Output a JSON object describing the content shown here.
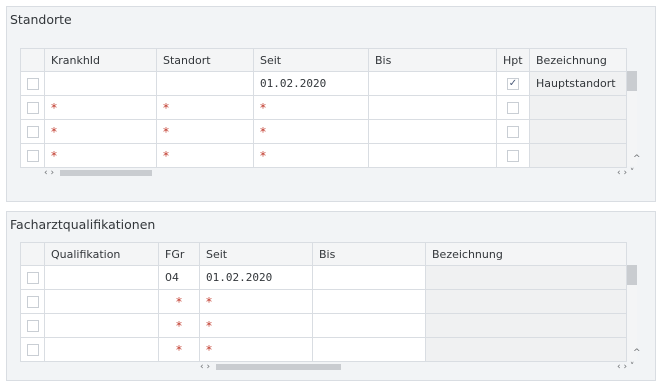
{
  "standorte": {
    "title": "Standorte",
    "columns": [
      "KrankhId",
      "Standort",
      "Seit",
      "Bis",
      "Hpt",
      "Bezeichnung"
    ],
    "rows": [
      {
        "krankhid": "",
        "standort": "",
        "seit": "01.02.2020",
        "bis": "",
        "hpt": "✓",
        "bezeichnung": "Hauptstandort"
      },
      {
        "krankhid": "*",
        "standort": "*",
        "seit": "*",
        "bis": "",
        "hpt": "",
        "bezeichnung": ""
      },
      {
        "krankhid": "*",
        "standort": "*",
        "seit": "*",
        "bis": "",
        "hpt": "",
        "bezeichnung": ""
      },
      {
        "krankhid": "*",
        "standort": "*",
        "seit": "*",
        "bis": "",
        "hpt": "",
        "bezeichnung": ""
      }
    ],
    "hscroll_left": "‹ ›",
    "hscroll_right": "‹ › ˅",
    "vscroll_up": "^"
  },
  "facharzt": {
    "title": "Facharztqualifikationen",
    "columns": [
      "Qualifikation",
      "FGr",
      "Seit",
      "Bis",
      "Bezeichnung"
    ],
    "rows": [
      {
        "qualifikation": "",
        "fgr": "04",
        "seit": "01.02.2020",
        "bis": "",
        "bezeichnung": ""
      },
      {
        "qualifikation": "",
        "fgr": "*",
        "seit": "*",
        "bis": "",
        "bezeichnung": ""
      },
      {
        "qualifikation": "",
        "fgr": "*",
        "seit": "*",
        "bis": "",
        "bezeichnung": ""
      },
      {
        "qualifikation": "",
        "fgr": "*",
        "seit": "*",
        "bis": "",
        "bezeichnung": ""
      }
    ],
    "hscroll_left": "‹ ›",
    "hscroll_right": "‹ › ˅",
    "vscroll_up": "^"
  }
}
